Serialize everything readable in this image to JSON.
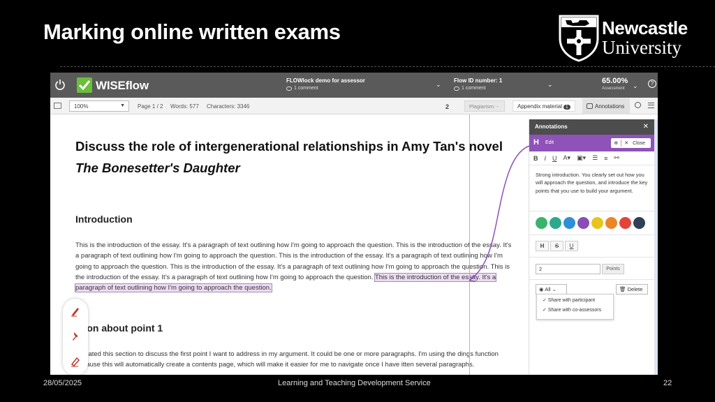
{
  "slide": {
    "title": "Marking online written exams",
    "logo": {
      "line1": "Newcastle",
      "line2": "University"
    },
    "footer_date": "28/05/2025",
    "footer_center": "Learning and Teaching Development Service",
    "footer_page": "22"
  },
  "topbar": {
    "brand": "WISEflow",
    "flow_title": "FLOWlock demo for assessor",
    "flow_comment": "1 comment",
    "flow_id": "Flow ID number: 1",
    "flow_id_comment": "1 comment",
    "score": "65.00%",
    "score_label": "Assessment"
  },
  "toolbar": {
    "zoom": "100%",
    "page": "Page 1 / 2",
    "words": "Words: 577",
    "characters": "Characters: 3346",
    "count": "2",
    "plagiarism": "Plagiarism: -",
    "appendix": "Appendix material",
    "appendix_count": "1",
    "annotations": "Annotations"
  },
  "document": {
    "title_part1": "Discuss the role of intergenerational relationships in Amy Tan's novel ",
    "title_italic": "The Bonesetter's Daughter",
    "heading1": "Introduction",
    "para1": "This is the introduction of the essay.  It's a paragraph of text outlining how I'm going to approach the question.  This is the introduction of the essay. It's a paragraph of text outlining how I'm going to approach the question.  This is the introduction of the essay. It's a paragraph of text outlining how I'm going to approach the question.  This is the introduction of the essay. It's a paragraph of text outlining how I'm going to approach the question.  This is the introduction of the essay. It's a paragraph of text outlining how I'm going to approach the question.",
    "para1_highlight": "This is the introduction of the essay. It's a paragraph of text outlining how I'm going to approach the question.",
    "heading2": "ction about point 1",
    "para2": "I created this section to discuss the first point I want to address in my argument.  It could be one or more paragraphs.  I'm using the dings function because this will automatically create a contents page, which will make it easier for me to  navigate once I have itten several paragraphs."
  },
  "panel": {
    "title": "Annotations",
    "edit_label": "Edit",
    "close_label": "Close",
    "comment": "Strong introduction.  You clearly set out how you will approach the question, and introduce the key points that you use to build your argument.",
    "colors": [
      "#3bb36b",
      "#2aaa8a",
      "#2f8fd6",
      "#8a4db8",
      "#e8c51e",
      "#e8872a",
      "#e2443a",
      "#2e4057"
    ],
    "points_value": "2",
    "points_label": "Points",
    "all_label": "All",
    "delete_label": "Delete",
    "share_participant": "Share with participant",
    "share_coassessors": "Share with co-assessors"
  },
  "accent": {
    "purple": "#8e52b9",
    "brand_green": "#6bbf3a"
  }
}
